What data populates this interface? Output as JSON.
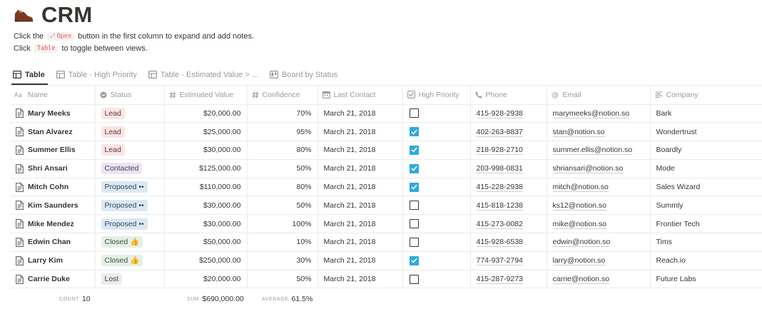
{
  "page": {
    "icon": "shoe-icon",
    "title": "CRM"
  },
  "description": {
    "line1_before": "Click the",
    "line1_code": "Open",
    "line1_after": "button in the first column to expand and add notes.",
    "line2_before": "Click",
    "line2_code": "Table",
    "line2_after": "to toggle between views."
  },
  "views": [
    {
      "label": "Table",
      "icon": "table-icon",
      "active": true
    },
    {
      "label": "Table - High Priority",
      "icon": "table-icon",
      "active": false
    },
    {
      "label": "Table - Estimated Value > ...",
      "icon": "table-icon",
      "active": false
    },
    {
      "label": "Board by Status",
      "icon": "board-icon",
      "active": false
    }
  ],
  "columns": [
    {
      "label": "Name",
      "icon": "title-icon"
    },
    {
      "label": "Status",
      "icon": "select-icon"
    },
    {
      "label": "Estimated Value",
      "icon": "number-icon"
    },
    {
      "label": "Confidence",
      "icon": "number-icon"
    },
    {
      "label": "Last Contact",
      "icon": "date-icon"
    },
    {
      "label": "High Priority",
      "icon": "checkbox-icon"
    },
    {
      "label": "Phone",
      "icon": "phone-icon"
    },
    {
      "label": "Email",
      "icon": "at-icon"
    },
    {
      "label": "Company",
      "icon": "text-icon"
    }
  ],
  "rows": [
    {
      "name": "Mary Meeks",
      "status": "Lead",
      "status_kind": "lead",
      "value": "$20,000.00",
      "confidence": "70%",
      "last_contact": "March 21, 2018",
      "priority": false,
      "phone": "415-928-2938",
      "email": "marymeeks@notion.so",
      "company": "Bark"
    },
    {
      "name": "Stan Alvarez",
      "status": "Lead",
      "status_kind": "lead",
      "value": "$25,000.00",
      "confidence": "95%",
      "last_contact": "March 21, 2018",
      "priority": true,
      "phone": "402-263-8837",
      "email": "stan@notion.so",
      "company": "Wondertrust"
    },
    {
      "name": "Summer Ellis",
      "status": "Lead",
      "status_kind": "lead",
      "value": "$30,000.00",
      "confidence": "80%",
      "last_contact": "March 21, 2018",
      "priority": true,
      "phone": "218-928-2710",
      "email": "summer.ellis@notion.so",
      "company": "Boardly"
    },
    {
      "name": "Shri Ansari",
      "status": "Contacted",
      "status_kind": "contacted",
      "value": "$125,000.00",
      "confidence": "50%",
      "last_contact": "March 21, 2018",
      "priority": true,
      "phone": "203-998-0831",
      "email": "shriansari@notion.so",
      "company": "Mode"
    },
    {
      "name": "Mitch Cohn",
      "status": "Proposed ••",
      "status_kind": "proposed",
      "value": "$110,000.00",
      "confidence": "80%",
      "last_contact": "March 21, 2018",
      "priority": true,
      "phone": "415-228-2938",
      "email": "mitch@notion.so",
      "company": "Sales Wizard"
    },
    {
      "name": "Kim Saunders",
      "status": "Proposed ••",
      "status_kind": "proposed",
      "value": "$30,000.00",
      "confidence": "50%",
      "last_contact": "March 21, 2018",
      "priority": false,
      "phone": "415-818-1238",
      "email": "ks12@notion.so",
      "company": "Summly"
    },
    {
      "name": "Mike Mendez",
      "status": "Proposed ••",
      "status_kind": "proposed",
      "value": "$30,000.00",
      "confidence": "100%",
      "last_contact": "March 21, 2018",
      "priority": false,
      "phone": "415-273-0082",
      "email": "mike@notion.so",
      "company": "Frontier Tech"
    },
    {
      "name": "Edwin Chan",
      "status": "Closed 👍",
      "status_kind": "closed",
      "value": "$50,000.00",
      "confidence": "10%",
      "last_contact": "March 21, 2018",
      "priority": false,
      "phone": "415-928-6538",
      "email": "edwin@notion.so",
      "company": "Tims"
    },
    {
      "name": "Larry Kim",
      "status": "Closed 👍",
      "status_kind": "closed",
      "value": "$250,000.00",
      "confidence": "30%",
      "last_contact": "March 21, 2018",
      "priority": true,
      "phone": "774-937-2794",
      "email": "larry@notion.so",
      "company": "Reach.io"
    },
    {
      "name": "Carrie Duke",
      "status": "Lost",
      "status_kind": "lost",
      "value": "$20,000.00",
      "confidence": "50%",
      "last_contact": "March 21, 2018",
      "priority": false,
      "phone": "415-287-9273",
      "email": "carrie@notion.so",
      "company": "Future Labs"
    }
  ],
  "footer": {
    "count_label": "COUNT",
    "count_value": "10",
    "sum_label": "SUM",
    "sum_value": "$690,000.00",
    "average_label": "AVERAGE",
    "average_value": "61.5%"
  },
  "colors": {
    "text": "#37352f",
    "muted": "#9b9a97",
    "checkbox_checked": "#2eaadc",
    "code_red": "#eb5757"
  }
}
